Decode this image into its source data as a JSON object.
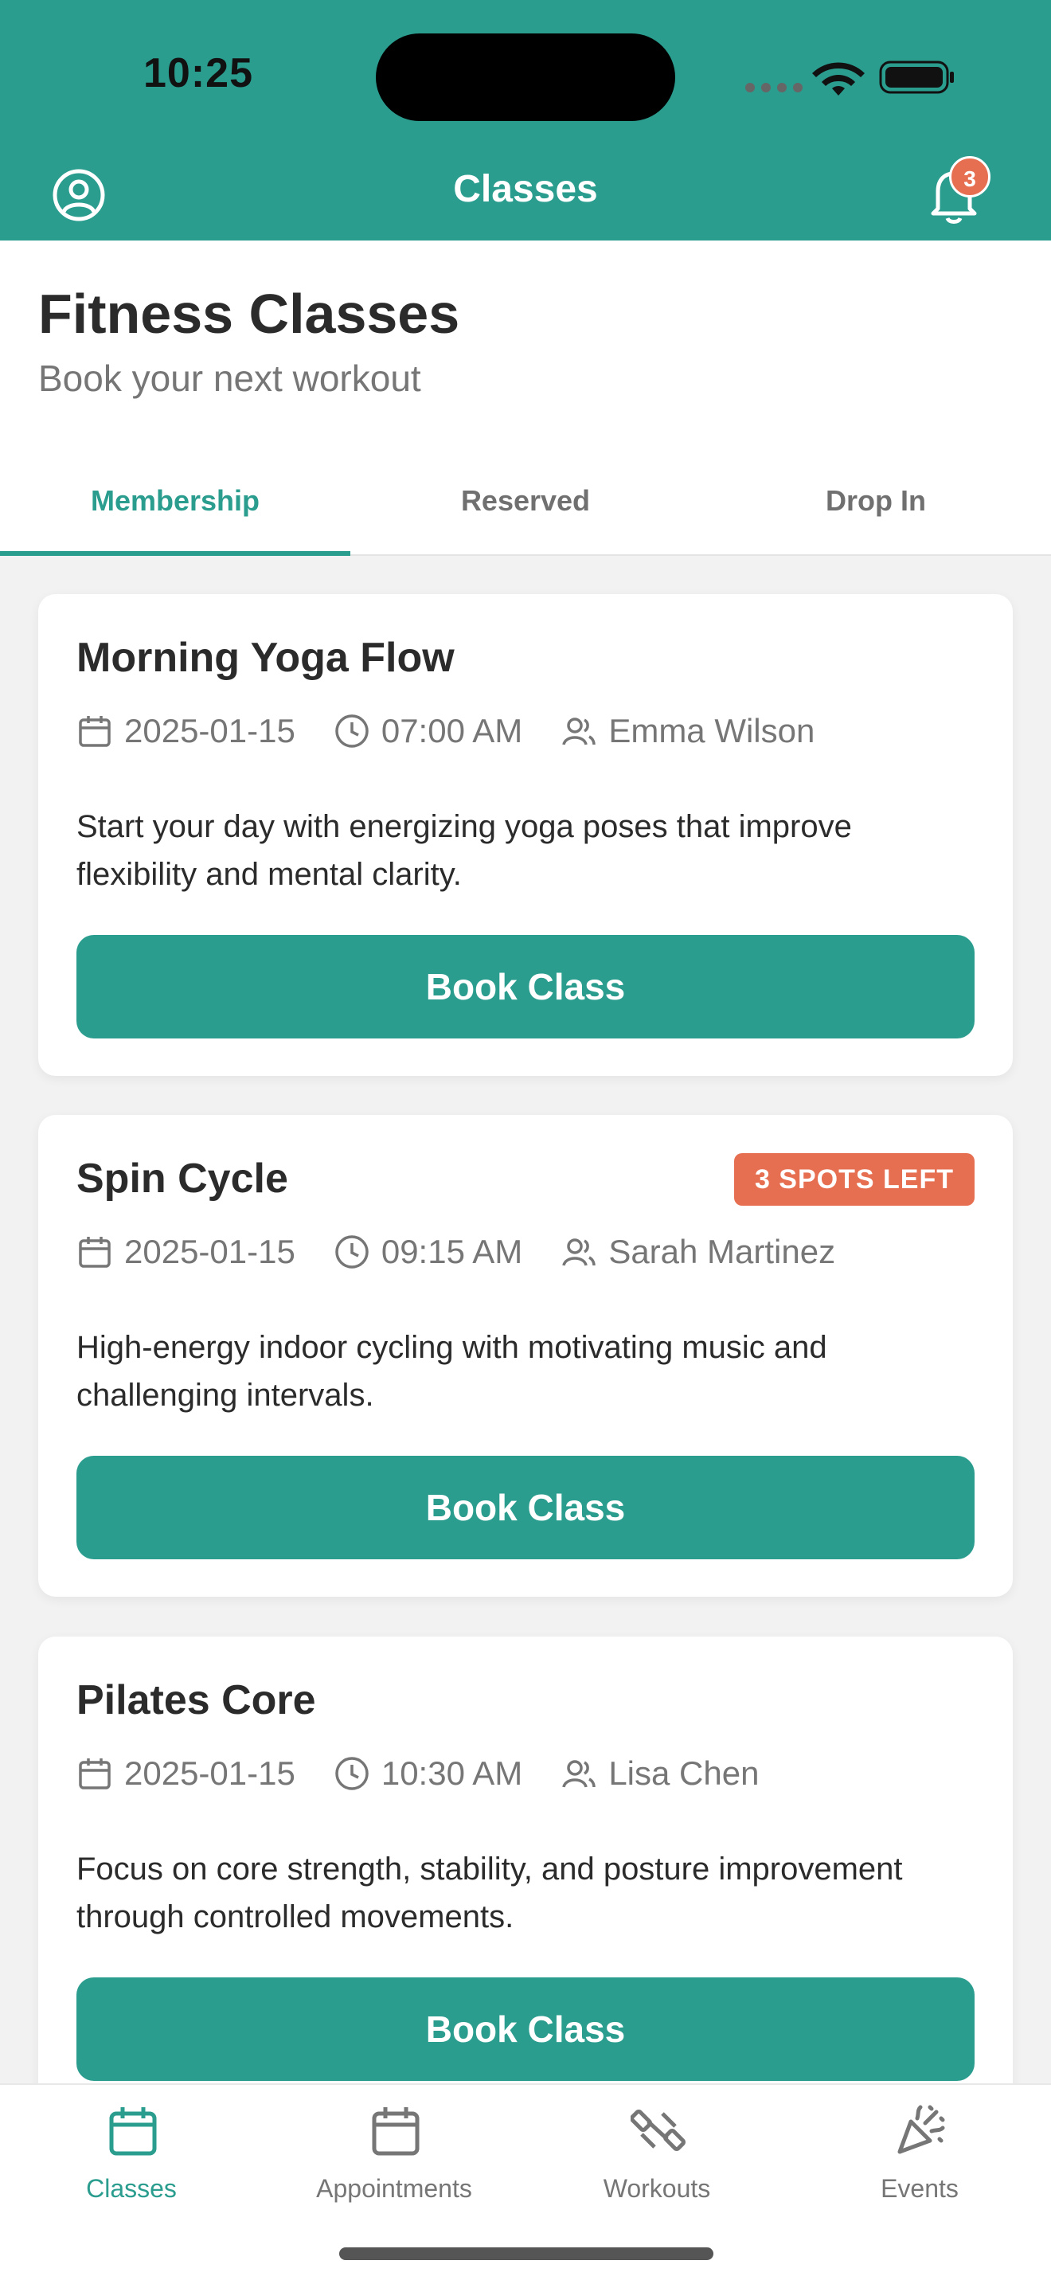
{
  "status_bar": {
    "time": "10:25"
  },
  "header": {
    "title": "Classes",
    "notification_count": "3"
  },
  "page": {
    "title": "Fitness Classes",
    "subtitle": "Book your next workout"
  },
  "tabs": [
    {
      "label": "Membership",
      "active": true
    },
    {
      "label": "Reserved",
      "active": false
    },
    {
      "label": "Drop In",
      "active": false
    }
  ],
  "classes": [
    {
      "title": "Morning Yoga Flow",
      "date": "2025-01-15",
      "time": "07:00 AM",
      "instructor": "Emma Wilson",
      "badge": "",
      "description": "Start your day with energizing yoga poses that improve flexibility and mental clarity.",
      "button": "Book Class"
    },
    {
      "title": "Spin Cycle",
      "date": "2025-01-15",
      "time": "09:15 AM",
      "instructor": "Sarah Martinez",
      "badge": "3 SPOTS LEFT",
      "description": "High-energy indoor cycling with motivating music and challenging intervals.",
      "button": "Book Class"
    },
    {
      "title": "Pilates Core",
      "date": "2025-01-15",
      "time": "10:30 AM",
      "instructor": "Lisa Chen",
      "badge": "",
      "description": "Focus on core strength, stability, and posture improvement through controlled movements.",
      "button": "Book Class"
    }
  ],
  "bottom_nav": [
    {
      "label": "Classes",
      "icon": "calendar-icon",
      "active": true
    },
    {
      "label": "Appointments",
      "icon": "calendar-icon",
      "active": false
    },
    {
      "label": "Workouts",
      "icon": "dumbbell-icon",
      "active": false
    },
    {
      "label": "Events",
      "icon": "party-popper-icon",
      "active": false
    }
  ],
  "colors": {
    "primary": "#2a9d8f",
    "accent": "#e76f51",
    "text": "#2b2b2b",
    "muted": "#767676",
    "background": "#f2f2f2"
  }
}
